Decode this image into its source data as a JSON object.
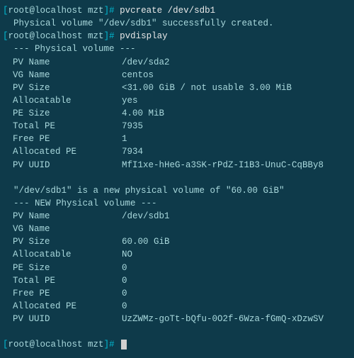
{
  "prompt": {
    "open": "[",
    "user": "root@localhost",
    "path": " mzt",
    "close": "]#"
  },
  "cmd1": "pvcreate /dev/sdb1",
  "cmd1_out": "  Physical volume \"/dev/sdb1\" successfully created.",
  "cmd2": "pvdisplay",
  "section1": "  --- Physical volume ---",
  "pv1": {
    "name_lbl": "PV Name",
    "name": "/dev/sda2",
    "vg_lbl": "VG Name",
    "vg": "centos",
    "size_lbl": "PV Size",
    "size": "<31.00 GiB / not usable 3.00 MiB",
    "alloc_lbl": "Allocatable",
    "alloc": "yes",
    "pesize_lbl": "PE Size",
    "pesize": "4.00 MiB",
    "totpe_lbl": "Total PE",
    "totpe": "7935",
    "freepe_lbl": "Free PE",
    "freepe": "1",
    "allocpe_lbl": "Allocated PE",
    "allocpe": "7934",
    "uuid_lbl": "PV UUID",
    "uuid": "MfI1xe-hHeG-a3SK-rPdZ-I1B3-UnuC-CqBBy8"
  },
  "newmsg": "  \"/dev/sdb1\" is a new physical volume of \"60.00 GiB\"",
  "section2": "  --- NEW Physical volume ---",
  "pv2": {
    "name_lbl": "PV Name",
    "name": "/dev/sdb1",
    "vg_lbl": "VG Name",
    "vg": "",
    "size_lbl": "PV Size",
    "size": "60.00 GiB",
    "alloc_lbl": "Allocatable",
    "alloc": "NO",
    "pesize_lbl": "PE Size",
    "pesize": "0",
    "totpe_lbl": "Total PE",
    "totpe": "0",
    "freepe_lbl": "Free PE",
    "freepe": "0",
    "allocpe_lbl": "Allocated PE",
    "allocpe": "0",
    "uuid_lbl": "PV UUID",
    "uuid": "UzZWMz-goTt-bQfu-0O2f-6Wza-fGmQ-xDzwSV"
  }
}
